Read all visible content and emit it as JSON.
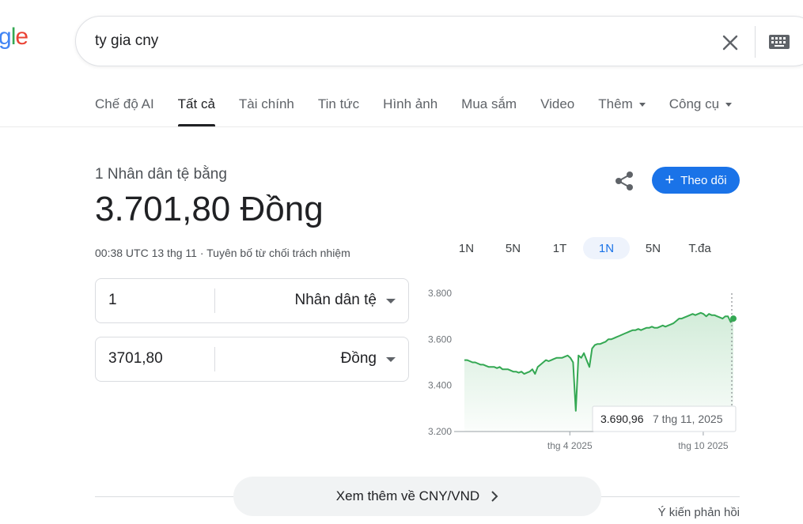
{
  "logo": {
    "letters": [
      "g",
      "l",
      "e"
    ],
    "colors": [
      "#4285f4",
      "#34a853",
      "#ea4335"
    ]
  },
  "search": {
    "query": "ty gia cny"
  },
  "tabs": [
    {
      "label": "Chế độ AI"
    },
    {
      "label": "Tất cả"
    },
    {
      "label": "Tài chính"
    },
    {
      "label": "Tin tức"
    },
    {
      "label": "Hình ảnh"
    },
    {
      "label": "Mua sắm"
    },
    {
      "label": "Video"
    },
    {
      "label": "Thêm"
    },
    {
      "label": "Công cụ"
    }
  ],
  "result": {
    "subtitle": "1 Nhân dân tệ bằng",
    "value": "3.701,80 Đồng",
    "timestamp": "00:38 UTC 13 thg 11",
    "separator": " · ",
    "disclaimer": "Tuyên bố từ chối trách nhiệm",
    "follow_label": "Theo dõi"
  },
  "converter": {
    "from": {
      "value": "1",
      "unit": "Nhân dân tệ"
    },
    "to": {
      "value": "3701,80",
      "unit": "Đồng"
    }
  },
  "ranges": [
    "1N",
    "5N",
    "1T",
    "1N",
    "5N",
    "T.đa"
  ],
  "active_range": 3,
  "chart_data": {
    "type": "area",
    "y_ticks": [
      "3.800",
      "3.600",
      "3.400",
      "3.200"
    ],
    "ylim": [
      3.2,
      3.8
    ],
    "x_ticks": [
      {
        "label": "thg 4 2025",
        "t": 0.392
      },
      {
        "label": "thg 10 2025",
        "t": 0.888
      }
    ],
    "series": [
      {
        "values": [
          3.51,
          3.51,
          3.505,
          3.5,
          3.5,
          3.495,
          3.49,
          3.49,
          3.485,
          3.48,
          3.48,
          3.48,
          3.475,
          3.48,
          3.47,
          3.47,
          3.47,
          3.465,
          3.46,
          3.46,
          3.455,
          3.46,
          3.45,
          3.455,
          3.46,
          3.47,
          3.45,
          3.48,
          3.49,
          3.5,
          3.51,
          3.505,
          3.51,
          3.515,
          3.52,
          3.52,
          3.52,
          3.525,
          3.53,
          3.52,
          3.5,
          3.29,
          3.53,
          3.52,
          3.54,
          3.51,
          3.48,
          3.56,
          3.575,
          3.58,
          3.58,
          3.585,
          3.59,
          3.6,
          3.6,
          3.605,
          3.61,
          3.615,
          3.62,
          3.625,
          3.63,
          3.635,
          3.64,
          3.64,
          3.645,
          3.64,
          3.645,
          3.65,
          3.65,
          3.655,
          3.65,
          3.65,
          3.655,
          3.66,
          3.655,
          3.66,
          3.665,
          3.67,
          3.68,
          3.69,
          3.69,
          3.695,
          3.7,
          3.705,
          3.71,
          3.705,
          3.71,
          3.715,
          3.71,
          3.7,
          3.71,
          3.705,
          3.705,
          3.7,
          3.695,
          3.69,
          3.7,
          3.7,
          3.675,
          3.69
        ]
      }
    ],
    "tooltip": {
      "value": "3.690,96",
      "date": "7 thg 11, 2025"
    },
    "line_color": "#34a853",
    "fill_color": "#e6f4ea"
  },
  "footer": {
    "more_label": "Xem thêm về CNY/VND",
    "feedback": "Ý kiến phản hồi"
  }
}
